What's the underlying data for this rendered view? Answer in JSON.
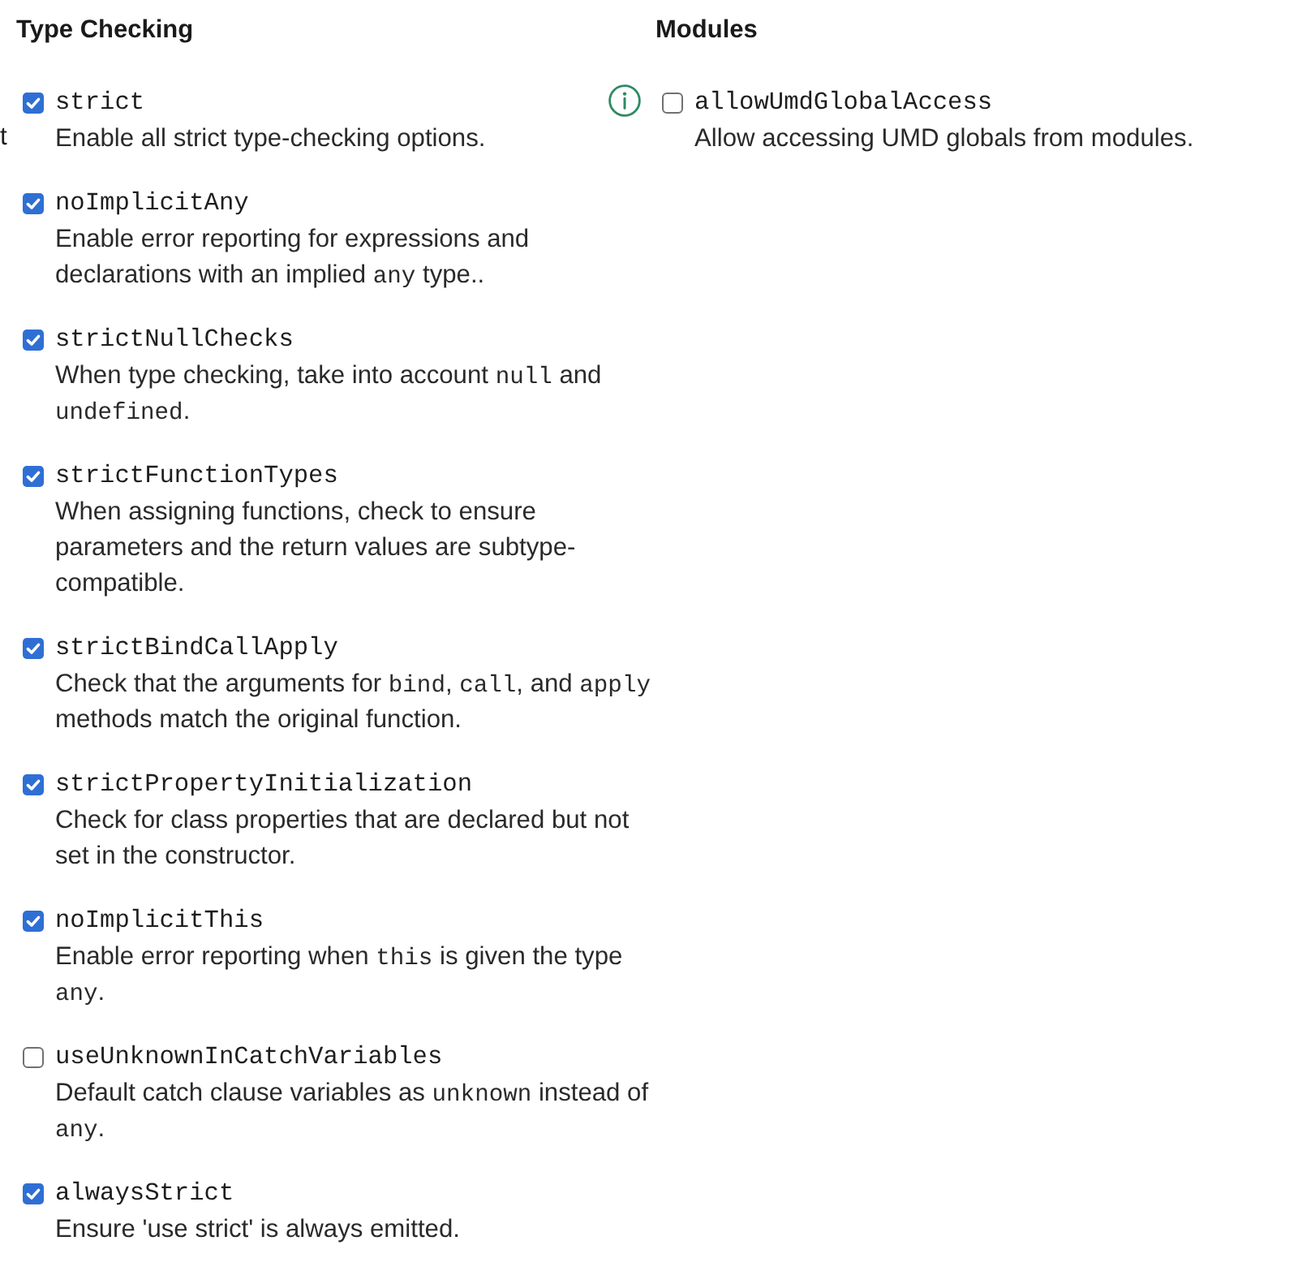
{
  "edge_fragment": "t",
  "type_checking": {
    "title": "Type Checking",
    "options": [
      {
        "name": "strict",
        "checked": true,
        "info": false,
        "description": [
          {
            "kind": "text",
            "text": "Enable all strict type-checking options."
          }
        ]
      },
      {
        "name": "noImplicitAny",
        "checked": true,
        "info": false,
        "description": [
          {
            "kind": "text",
            "text": "Enable error reporting for expressions and declarations with an implied "
          },
          {
            "kind": "code",
            "text": "any"
          },
          {
            "kind": "text",
            "text": " type.."
          }
        ]
      },
      {
        "name": "strictNullChecks",
        "checked": true,
        "info": false,
        "description": [
          {
            "kind": "text",
            "text": "When type checking, take into account "
          },
          {
            "kind": "code",
            "text": "null"
          },
          {
            "kind": "text",
            "text": " and "
          },
          {
            "kind": "code",
            "text": "undefined"
          },
          {
            "kind": "text",
            "text": "."
          }
        ]
      },
      {
        "name": "strictFunctionTypes",
        "checked": true,
        "info": false,
        "description": [
          {
            "kind": "text",
            "text": "When assigning functions, check to ensure parameters and the return values are subtype-compatible."
          }
        ]
      },
      {
        "name": "strictBindCallApply",
        "checked": true,
        "info": false,
        "description": [
          {
            "kind": "text",
            "text": "Check that the arguments for "
          },
          {
            "kind": "code",
            "text": "bind"
          },
          {
            "kind": "text",
            "text": ", "
          },
          {
            "kind": "code",
            "text": "call"
          },
          {
            "kind": "text",
            "text": ", and "
          },
          {
            "kind": "code",
            "text": "apply"
          },
          {
            "kind": "text",
            "text": " methods match the original function."
          }
        ]
      },
      {
        "name": "strictPropertyInitialization",
        "checked": true,
        "info": false,
        "description": [
          {
            "kind": "text",
            "text": "Check for class properties that are declared but not set in the constructor."
          }
        ]
      },
      {
        "name": "noImplicitThis",
        "checked": true,
        "info": false,
        "description": [
          {
            "kind": "text",
            "text": "Enable error reporting when "
          },
          {
            "kind": "code",
            "text": "this"
          },
          {
            "kind": "text",
            "text": " is given the type "
          },
          {
            "kind": "code",
            "text": "any"
          },
          {
            "kind": "text",
            "text": "."
          }
        ]
      },
      {
        "name": "useUnknownInCatchVariables",
        "checked": false,
        "info": false,
        "description": [
          {
            "kind": "text",
            "text": "Default catch clause variables as "
          },
          {
            "kind": "code",
            "text": "unknown"
          },
          {
            "kind": "text",
            "text": " instead of "
          },
          {
            "kind": "code",
            "text": "any"
          },
          {
            "kind": "text",
            "text": "."
          }
        ]
      },
      {
        "name": "alwaysStrict",
        "checked": true,
        "info": false,
        "description": [
          {
            "kind": "text",
            "text": "Ensure 'use strict' is always emitted."
          }
        ]
      }
    ]
  },
  "modules": {
    "title": "Modules",
    "options": [
      {
        "name": "allowUmdGlobalAccess",
        "checked": false,
        "info": true,
        "description": [
          {
            "kind": "text",
            "text": "Allow accessing UMD globals from modules."
          }
        ]
      }
    ]
  }
}
